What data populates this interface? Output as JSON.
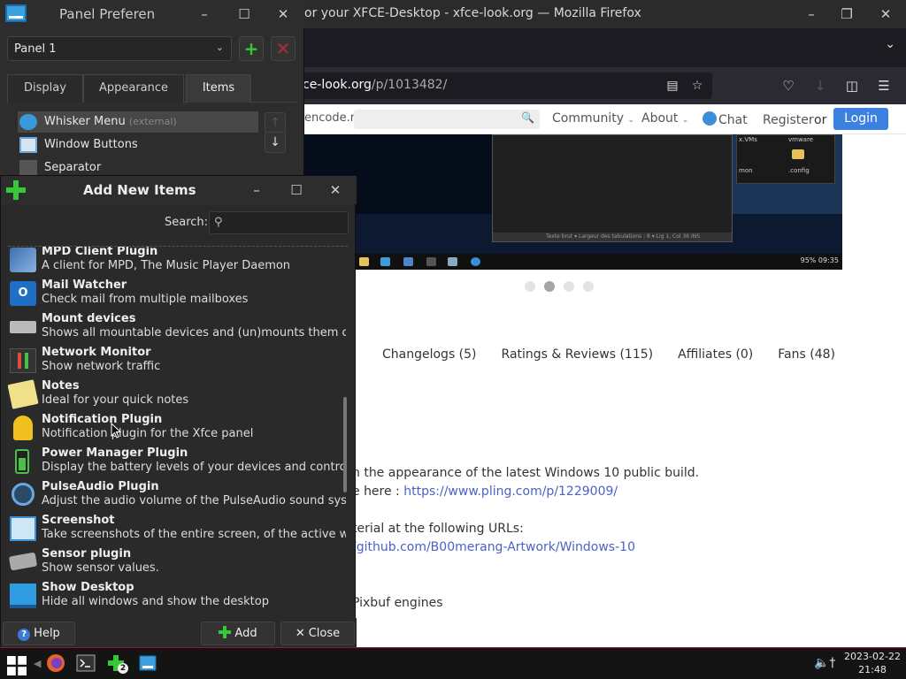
{
  "firefox": {
    "title": "or your XFCE-Desktop - xfce-look.org — Mozilla Firefox",
    "url_host": "ce-look.org",
    "url_path": "/p/1013482/",
    "site": {
      "search_prefix": "encode.n",
      "nav_community": "Community",
      "nav_about": "About",
      "nav_chat": "Chat",
      "register": "Register",
      "or": "or",
      "login": "Login"
    },
    "screenshot": {
      "status_text": "Texte brut ▾    Largeur des tabulations : 8 ▾    Lig 1, Col 36    INS",
      "vms_label": "x.VMs",
      "vmware_label": "vmware",
      "mon_label": "mon",
      "config_label": ".config",
      "tray_text": "95%  09:35"
    },
    "content_tabs": [
      "Changelogs (5)",
      "Ratings & Reviews (115)",
      "Affiliates (0)",
      "Fans (48)"
    ],
    "desc": {
      "line1": "n the appearance of the latest Windows 10 public build.",
      "line2_prefix": "e here : ",
      "line2_link": "https://www.pling.com/p/1229009/",
      "line3": "terial at the following URLs:",
      "line4_link": "/github.com/B00merang-Artwork/Windows-10",
      "line5": "Pixbuf engines"
    }
  },
  "panel_prefs": {
    "title": "Panel Preferen",
    "panel_select": "Panel 1",
    "tabs": [
      "Display",
      "Appearance",
      "Items"
    ],
    "items": [
      {
        "label": "Whisker Menu",
        "ext": "(external)"
      },
      {
        "label": "Window Buttons"
      },
      {
        "label": "Separator"
      }
    ]
  },
  "add_items": {
    "title": "Add New Items",
    "search_label": "Search:",
    "search_value": "",
    "plugins": [
      {
        "name": "MPD Client Plugin",
        "desc": "A client for MPD, The Music Player Daemon",
        "icon": "music-player-icon"
      },
      {
        "name": "Mail Watcher",
        "desc": "Check mail from multiple mailboxes",
        "icon": "mail-icon"
      },
      {
        "name": "Mount devices",
        "desc": "Shows all mountable devices and (un)mounts them on ...",
        "icon": "drive-icon"
      },
      {
        "name": "Network Monitor",
        "desc": "Show network traffic",
        "icon": "network-icon"
      },
      {
        "name": "Notes",
        "desc": "Ideal for your quick notes",
        "icon": "notes-icon"
      },
      {
        "name": "Notification Plugin",
        "desc": "Notification plugin for the Xfce panel",
        "icon": "bell-icon"
      },
      {
        "name": "Power Manager Plugin",
        "desc": "Display the battery levels of your devices and control t...",
        "icon": "battery-icon"
      },
      {
        "name": "PulseAudio Plugin",
        "desc": "Adjust the audio volume of the PulseAudio sound system",
        "icon": "speaker-icon"
      },
      {
        "name": "Screenshot",
        "desc": "Take screenshots of the entire screen, of the active win...",
        "icon": "screenshot-icon"
      },
      {
        "name": "Sensor plugin",
        "desc": "Show sensor values.",
        "icon": "sensor-icon"
      },
      {
        "name": "Show Desktop",
        "desc": "Hide all windows and show the desktop",
        "icon": "desktop-icon"
      }
    ],
    "help": "Help",
    "add": "Add",
    "close": "Close"
  },
  "taskbar": {
    "badge": "2",
    "date": "2023-02-22",
    "time": "21:48"
  },
  "colors": {
    "accent_green": "#37c837",
    "login_blue": "#3b82e0",
    "link": "#4a62c8",
    "taskbar_border": "#8a1a3a"
  }
}
